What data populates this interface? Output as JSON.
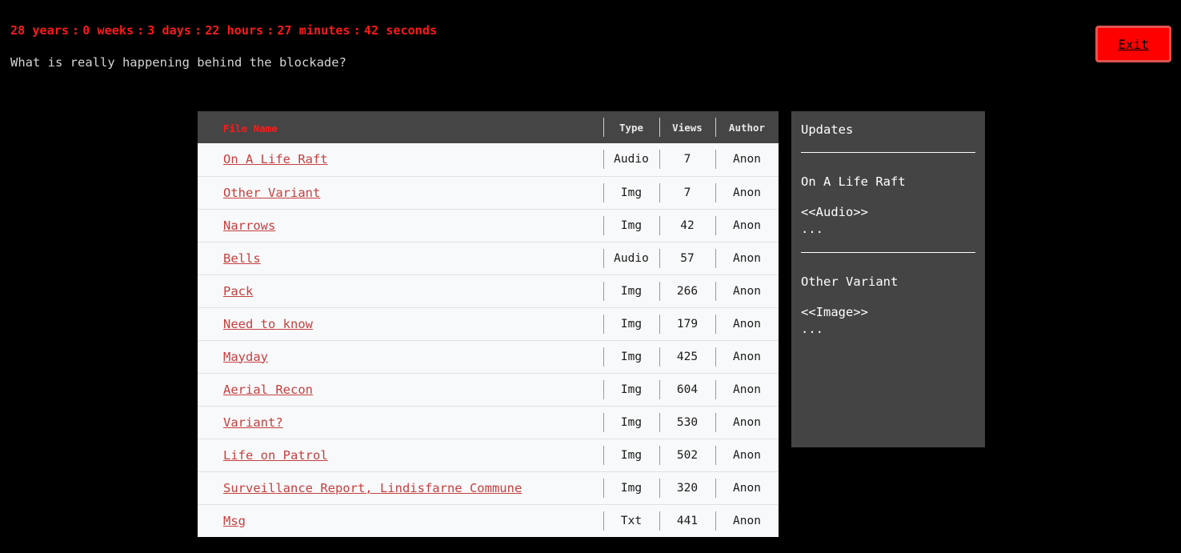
{
  "countdown": {
    "years": "28 years",
    "weeks": "0 weeks",
    "days": "3 days",
    "hours": "22 hours",
    "minutes": "27 minutes",
    "seconds": "42 seconds",
    "separator": ":"
  },
  "subtitle": "What is really happening behind the blockade?",
  "exit_label": "Exit",
  "table": {
    "headers": {
      "name": "File Name",
      "type": "Type",
      "views": "Views",
      "author": "Author"
    },
    "rows": [
      {
        "name": "On A Life Raft",
        "type": "Audio",
        "views": "7",
        "author": "Anon"
      },
      {
        "name": "Other Variant",
        "type": "Img",
        "views": "7",
        "author": "Anon"
      },
      {
        "name": "Narrows",
        "type": "Img",
        "views": "42",
        "author": "Anon"
      },
      {
        "name": "Bells",
        "type": "Audio",
        "views": "57",
        "author": "Anon"
      },
      {
        "name": "Pack",
        "type": "Img",
        "views": "266",
        "author": "Anon"
      },
      {
        "name": "Need to know",
        "type": "Img",
        "views": "179",
        "author": "Anon"
      },
      {
        "name": "Mayday",
        "type": "Img",
        "views": "425",
        "author": "Anon"
      },
      {
        "name": "Aerial Recon",
        "type": "Img",
        "views": "604",
        "author": "Anon"
      },
      {
        "name": "Variant?",
        "type": "Img",
        "views": "530",
        "author": "Anon"
      },
      {
        "name": "Life on Patrol",
        "type": "Img",
        "views": "502",
        "author": "Anon"
      },
      {
        "name": "Surveillance Report, Lindisfarne Commune",
        "type": "Img",
        "views": "320",
        "author": "Anon"
      },
      {
        "name": "Msg",
        "type": "Txt",
        "views": "441",
        "author": "Anon"
      }
    ]
  },
  "updates": {
    "title": "Updates",
    "items": [
      {
        "name": "On A Life Raft",
        "type": "<<Audio>>",
        "more": "..."
      },
      {
        "name": "Other Variant",
        "type": "<<Image>>",
        "more": "..."
      }
    ]
  },
  "colors": {
    "accent_red": "#ff1a1a",
    "background": "#000000",
    "header_gray": "#454545",
    "panel_gray": "#444444",
    "link_red": "#c44040"
  }
}
